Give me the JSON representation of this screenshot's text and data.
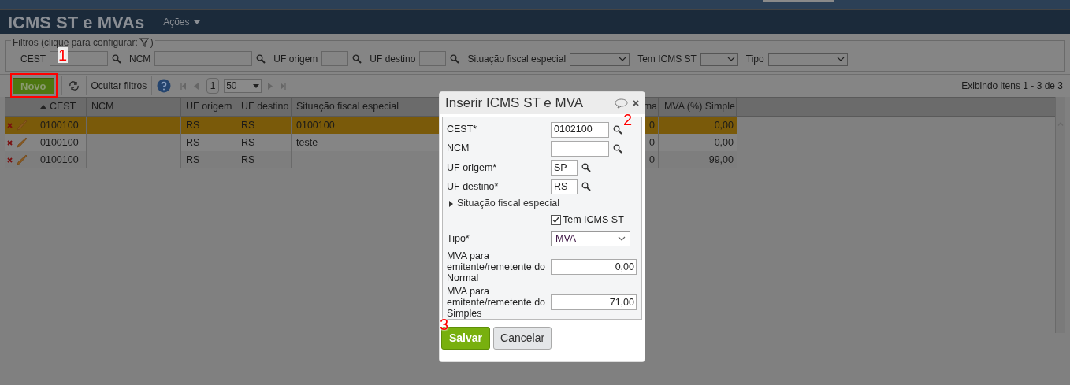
{
  "header": {
    "title": "ICMS ST e MVAs",
    "menu": "Ações"
  },
  "filters": {
    "legend": "Filtros (clique para configurar:",
    "legend_end": ")",
    "fields": [
      {
        "label": "CEST",
        "kind": "search"
      },
      {
        "label": "NCM",
        "kind": "search"
      },
      {
        "label": "UF origem",
        "kind": "search"
      },
      {
        "label": "UF destino",
        "kind": "search"
      },
      {
        "label": "Situação fiscal especial",
        "kind": "select"
      },
      {
        "label": "Tem ICMS ST",
        "kind": "select"
      },
      {
        "label": "Tipo",
        "kind": "select"
      }
    ]
  },
  "toolbar": {
    "new_button": "Novo",
    "hide_filters": "Ocultar filtros",
    "page": "1",
    "page_size": "50",
    "item_count": "Exibindo itens 1 - 3 de 3"
  },
  "table": {
    "columns": [
      {
        "label": "CEST",
        "sorted": true
      },
      {
        "label": "NCM",
        "sorted": false
      },
      {
        "label": "UF origem",
        "sorted": false
      },
      {
        "label": "UF destino",
        "sorted": false
      },
      {
        "label": "Situação fiscal especial",
        "sorted": false
      },
      {
        "label": "ma",
        "sorted": false
      },
      {
        "label": "MVA (%) Simple",
        "sorted": false
      }
    ],
    "rows": [
      {
        "selected": true,
        "cells": [
          "0100100",
          "",
          "RS",
          "RS",
          "0100100",
          "0",
          "0,00"
        ]
      },
      {
        "selected": false,
        "cells": [
          "0100100",
          "",
          "RS",
          "RS",
          "teste",
          "0",
          "0,00"
        ]
      },
      {
        "selected": false,
        "cells": [
          "0100100",
          "",
          "RS",
          "RS",
          "",
          "0",
          "99,00"
        ]
      }
    ]
  },
  "dialog": {
    "title": "Inserir ICMS ST e MVA",
    "fields": [
      {
        "kind": "search",
        "label": "CEST*",
        "value": "0102100"
      },
      {
        "kind": "search",
        "label": "NCM"
      },
      {
        "kind": "search",
        "label": "UF origem*",
        "value": "SP"
      },
      {
        "kind": "search",
        "label": "UF destino*",
        "value": "RS"
      },
      {
        "kind": "section",
        "label": "Situação fiscal especial",
        "expanded": false
      },
      {
        "kind": "check",
        "label": "Tem ICMS ST",
        "checked": true
      },
      {
        "kind": "select",
        "label": "Tipo*",
        "value": "MVA"
      },
      {
        "kind": "number",
        "label": "MVA para emitente/remetente do Normal",
        "value": "0,00"
      },
      {
        "kind": "number",
        "label": "MVA para emitente/remetente do Simples",
        "value": "71,00"
      }
    ],
    "buttons": [
      {
        "label": "Salvar",
        "kind": "primary"
      },
      {
        "label": "Cancelar",
        "kind": "secondary"
      }
    ]
  },
  "annotations": [
    "1",
    "2",
    "3"
  ]
}
